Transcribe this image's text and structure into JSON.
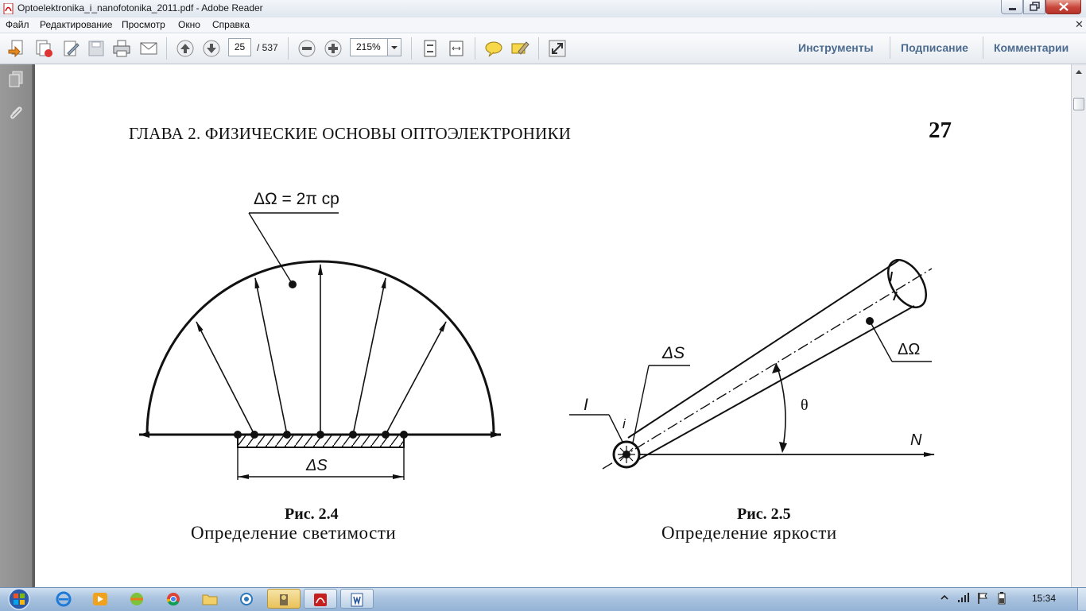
{
  "window": {
    "title": "Optoelektronika_i_nanofotonika_2011.pdf - Adobe Reader"
  },
  "menu": {
    "items": [
      "Файл",
      "Редактирование",
      "Просмотр",
      "Окно",
      "Справка"
    ]
  },
  "toolbar": {
    "page_current": "25",
    "page_total": "/ 537",
    "zoom": "215%",
    "right_links": [
      "Инструменты",
      "Подписание",
      "Комментарии"
    ]
  },
  "page": {
    "header": "ГЛАВА 2. ФИЗИЧЕСКИЕ ОСНОВЫ ОПТОЭЛЕКТРОНИКИ",
    "page_number": "27"
  },
  "figure_left": {
    "label_omega": "ΔΩ = 2π ср",
    "label_area": "ΔS",
    "caption_title": "Рис. 2.4",
    "caption_text": "Определение светимости"
  },
  "figure_right": {
    "label_area": "ΔS",
    "label_I": "I",
    "label_i": "i",
    "label_omega": "ΔΩ",
    "label_theta": "θ",
    "label_N": "N",
    "caption_title": "Рис. 2.5",
    "caption_text": "Определение яркости"
  },
  "taskbar": {
    "clock": "15:34"
  },
  "colors": {
    "toolbar_link": "#4c6b8f",
    "nav_panel": "#8f8f8f",
    "taskbar": "#a9c3df"
  }
}
